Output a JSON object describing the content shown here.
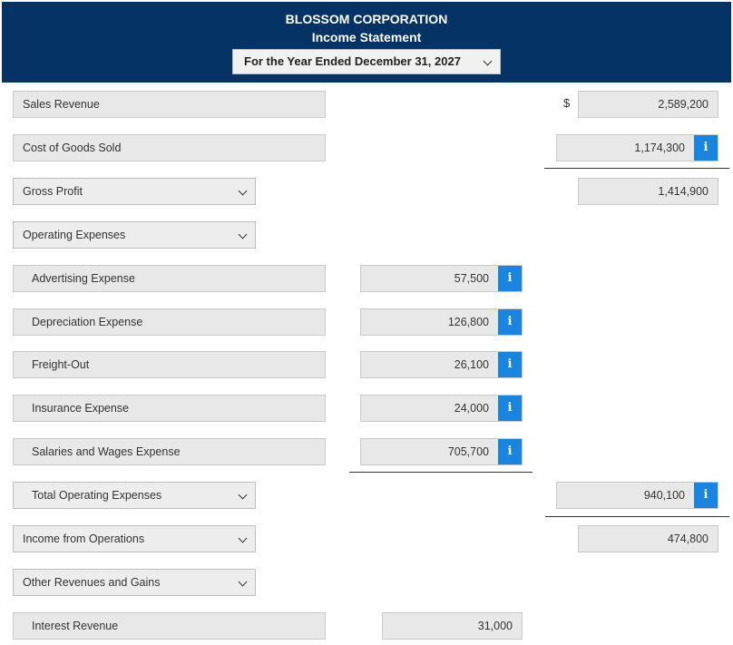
{
  "header": {
    "company": "BLOSSOM CORPORATION",
    "title": "Income Statement",
    "period": "For the Year Ended December 31, 2027"
  },
  "currency_symbol": "$",
  "icons": {
    "info": "info-icon",
    "info_glyph": "i",
    "dropdown": "chevron-down-icon"
  },
  "colors": {
    "header_bg": "#063366",
    "info_bg": "#1a85e0"
  },
  "rows": {
    "sales_revenue": {
      "label": "Sales Revenue",
      "amount": "2,589,200"
    },
    "cogs": {
      "label": "Cost of Goods Sold",
      "amount": "1,174,300"
    },
    "gross_profit": {
      "label": "Gross Profit",
      "amount": "1,414,900"
    },
    "operating_expenses": {
      "label": "Operating Expenses"
    },
    "advertising": {
      "label": "Advertising Expense",
      "amount": "57,500"
    },
    "depreciation": {
      "label": "Depreciation Expense",
      "amount": "126,800"
    },
    "freight": {
      "label": "Freight-Out",
      "amount": "26,100"
    },
    "insurance": {
      "label": "Insurance Expense",
      "amount": "24,000"
    },
    "salaries": {
      "label": "Salaries and Wages Expense",
      "amount": "705,700"
    },
    "total_operating": {
      "label": "Total Operating Expenses",
      "amount": "940,100"
    },
    "income_operations": {
      "label": "Income from Operations",
      "amount": "474,800"
    },
    "other_revenues": {
      "label": "Other Revenues and Gains"
    },
    "interest_revenue": {
      "label": "Interest Revenue",
      "amount": "31,000"
    }
  }
}
